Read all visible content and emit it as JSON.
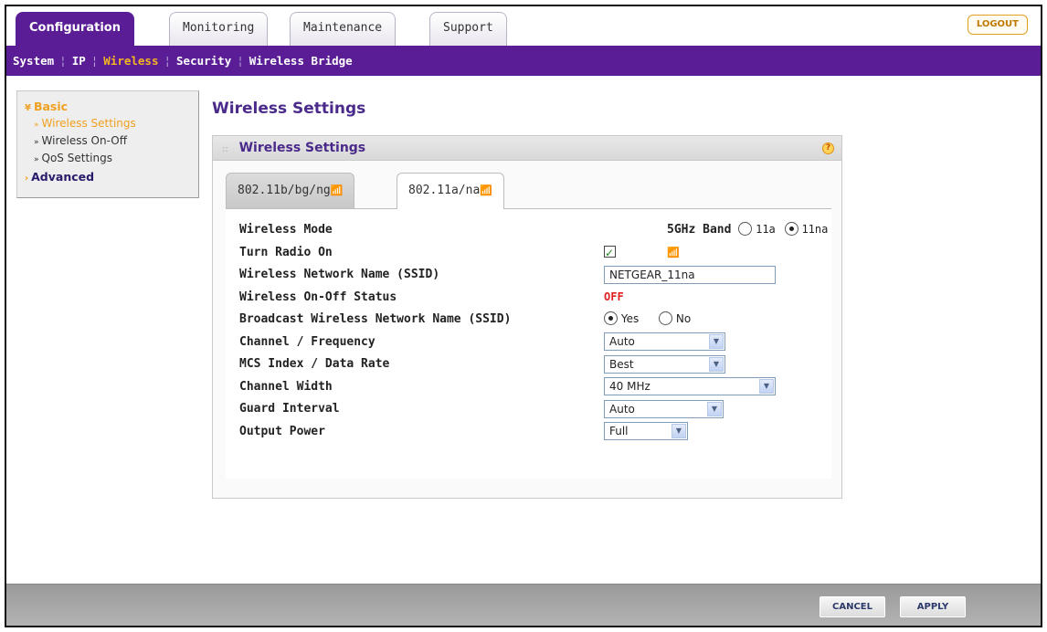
{
  "top_tabs": [
    "Configuration",
    "Monitoring",
    "Maintenance",
    "Support"
  ],
  "logout_label": "LOGOUT",
  "subnav": [
    "System",
    "IP",
    "Wireless",
    "Security",
    "Wireless Bridge"
  ],
  "left_menu": {
    "basic": "Basic",
    "items": [
      "Wireless Settings",
      "Wireless On-Off",
      "QoS Settings"
    ],
    "advanced": "Advanced"
  },
  "page_title": "Wireless Settings",
  "panel_title": "Wireless Settings",
  "help_icon": "?",
  "sub_tabs": [
    "802.11b/bg/ng",
    "802.11a/na"
  ],
  "form": {
    "wireless_mode": {
      "label": "Wireless Mode",
      "band_label": "5GHz Band",
      "options": [
        "11a",
        "11na"
      ],
      "selected": "11na"
    },
    "turn_radio_on": {
      "label": "Turn Radio On",
      "checked": true
    },
    "ssid": {
      "label": "Wireless Network Name (SSID)",
      "value": "NETGEAR_11na"
    },
    "onoff_status": {
      "label": "Wireless On-Off Status",
      "value": "OFF"
    },
    "broadcast": {
      "label": "Broadcast Wireless Network Name (SSID)",
      "options": [
        "Yes",
        "No"
      ],
      "selected": "Yes"
    },
    "channel": {
      "label": "Channel / Frequency",
      "value": "Auto"
    },
    "mcs": {
      "label": "MCS Index / Data Rate",
      "value": "Best"
    },
    "channel_width": {
      "label": "Channel Width",
      "value": "40 MHz"
    },
    "guard_interval": {
      "label": "Guard Interval",
      "value": "Auto"
    },
    "output_power": {
      "label": "Output Power",
      "value": "Full"
    }
  },
  "buttons": {
    "cancel": "CANCEL",
    "apply": "APPLY"
  },
  "colors": {
    "brand_purple": "#5a1d96",
    "accent_orange": "#f0a020",
    "status_off": "#e02020"
  }
}
